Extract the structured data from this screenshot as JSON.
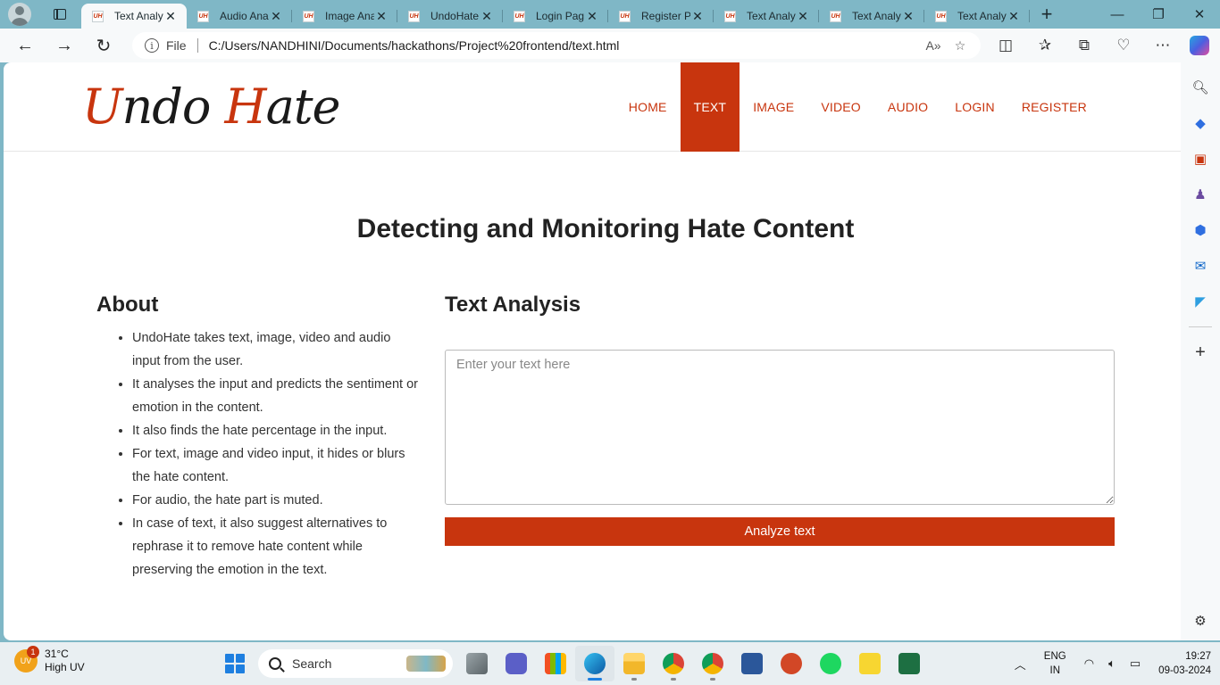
{
  "browser": {
    "tabs": [
      {
        "title": "Text Analy",
        "favicon": "UH"
      },
      {
        "title": "Audio Ana",
        "favicon": "UH"
      },
      {
        "title": "Image Ana",
        "favicon": "UH"
      },
      {
        "title": "UndoHate",
        "favicon": "UH"
      },
      {
        "title": "Login Pag",
        "favicon": "UH"
      },
      {
        "title": "Register P",
        "favicon": "UH"
      },
      {
        "title": "Text Analy",
        "favicon": "UH"
      },
      {
        "title": "Text Analy",
        "favicon": "UH"
      },
      {
        "title": "Text Analy",
        "favicon": "UH"
      }
    ],
    "address": {
      "scheme_label": "File",
      "url": "C:/Users/NANDHINI/Documents/hackathons/Project%20frontend/text.html"
    }
  },
  "site": {
    "logo_part1": "U",
    "logo_part2": "ndo ",
    "logo_part3": "H",
    "logo_part4": "ate",
    "nav": [
      "HOME",
      "TEXT",
      "IMAGE",
      "VIDEO",
      "AUDIO",
      "LOGIN",
      "REGISTER"
    ],
    "active_nav": "TEXT",
    "accent_color": "#c8350e"
  },
  "page": {
    "title": "Detecting and Monitoring Hate Content",
    "about_heading": "About",
    "about_items": [
      "UndoHate takes text, image, video and audio input from the user.",
      "It analyses the input and predicts the sentiment or emotion in the content.",
      "It also finds the hate percentage in the input.",
      "For text, image and video input, it hides or blurs the hate content.",
      "For audio, the hate part is muted.",
      "In case of text, it also suggest alternatives to rephrase it to remove hate content while preserving the emotion in the text."
    ],
    "analysis_heading": "Text Analysis",
    "text_placeholder": "Enter your text here",
    "text_value": "",
    "analyze_button": "Analyze text"
  },
  "taskbar": {
    "weather_temp": "31°C",
    "weather_desc": "High UV",
    "weather_badge": "1",
    "search_label": "Search",
    "language_line1": "ENG",
    "language_line2": "IN",
    "time": "19:27",
    "date": "09-03-2024"
  }
}
